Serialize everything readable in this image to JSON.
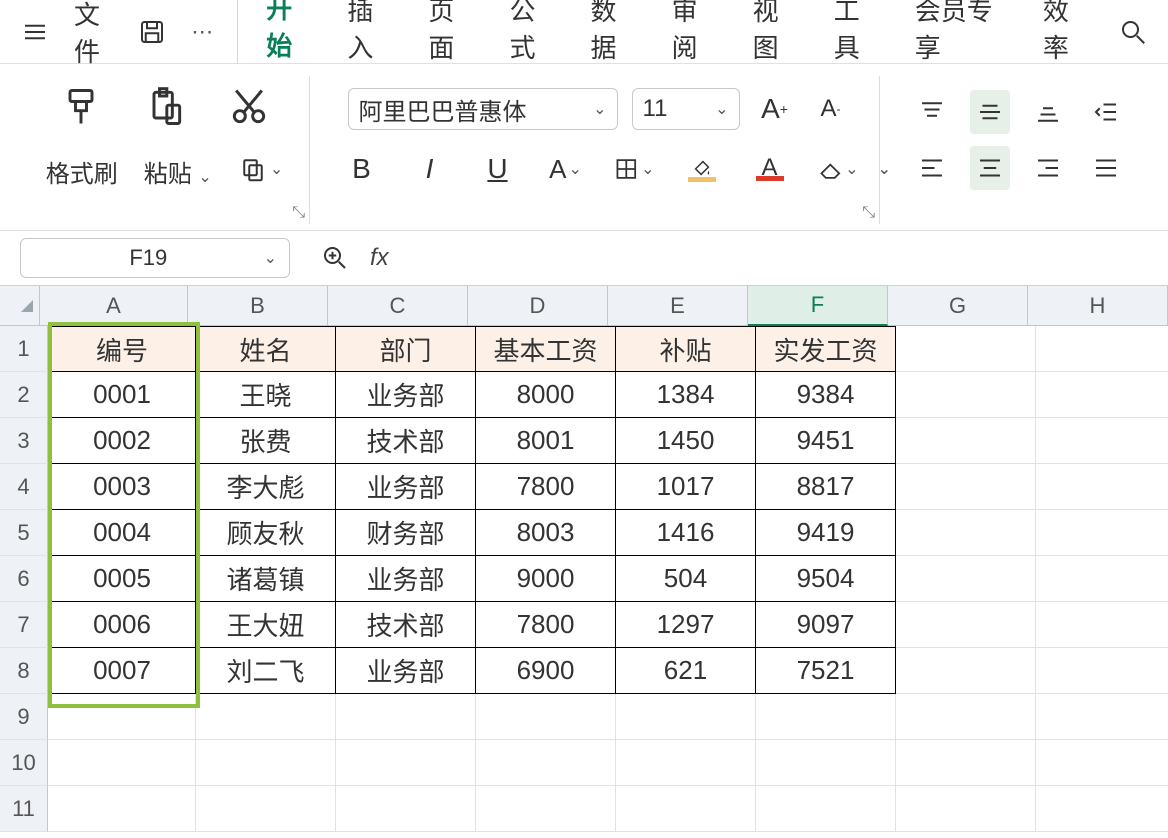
{
  "menubar": {
    "file": "文件",
    "tabs": [
      "开始",
      "插入",
      "页面",
      "公式",
      "数据",
      "审阅",
      "视图",
      "工具",
      "会员专享",
      "效率"
    ],
    "active_index": 0
  },
  "ribbon": {
    "format_painter": "格式刷",
    "paste": "粘贴",
    "font_name": "阿里巴巴普惠体",
    "font_size": "11",
    "fill_color": "#f5c06a",
    "text_color": "#d93a2a"
  },
  "namebox": "F19",
  "fx_label": "fx",
  "columns": [
    "A",
    "B",
    "C",
    "D",
    "E",
    "F",
    "G",
    "H"
  ],
  "selected_col_index": 5,
  "row_count": 11,
  "table": {
    "headers": [
      "编号",
      "姓名",
      "部门",
      "基本工资",
      "补贴",
      "实发工资"
    ],
    "rows": [
      [
        "0001",
        "王晓",
        "业务部",
        "8000",
        "1384",
        "9384"
      ],
      [
        "0002",
        "张费",
        "技术部",
        "8001",
        "1450",
        "9451"
      ],
      [
        "0003",
        "李大彪",
        "业务部",
        "7800",
        "1017",
        "8817"
      ],
      [
        "0004",
        "顾友秋",
        "财务部",
        "8003",
        "1416",
        "9419"
      ],
      [
        "0005",
        "诸葛镇",
        "业务部",
        "9000",
        "504",
        "9504"
      ],
      [
        "0006",
        "王大妞",
        "技术部",
        "7800",
        "1297",
        "9097"
      ],
      [
        "0007",
        "刘二飞",
        "业务部",
        "6900",
        "621",
        "7521"
      ]
    ]
  }
}
